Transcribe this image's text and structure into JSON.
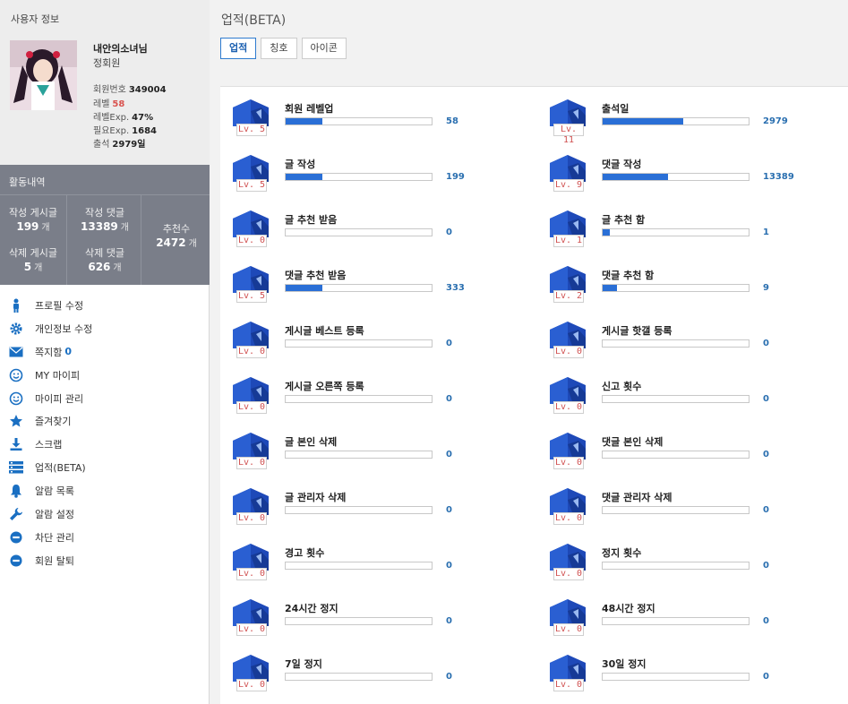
{
  "user": {
    "header": "사용자 정보",
    "nickname": "내안의소녀님",
    "grade": "정회원",
    "stats": [
      {
        "label": "회원번호",
        "value": "349004",
        "red": false
      },
      {
        "label": "레벨",
        "value": "58",
        "red": true
      },
      {
        "label": "레벨Exp.",
        "value": "47%",
        "red": false
      },
      {
        "label": "필요Exp.",
        "value": "1684",
        "red": false
      },
      {
        "label": "출석",
        "value": "2979일",
        "red": false
      }
    ]
  },
  "activity": {
    "title": "활동내역",
    "posts_label": "작성 게시글",
    "posts_value": "199",
    "posts_unit": "개",
    "comments_label": "작성 댓글",
    "comments_value": "13389",
    "comments_unit": "개",
    "del_posts_label": "삭제 게시글",
    "del_posts_value": "5",
    "del_posts_unit": "개",
    "del_comments_label": "삭제 댓글",
    "del_comments_value": "626",
    "del_comments_unit": "개",
    "recommend_label": "추천수",
    "recommend_value": "2472",
    "recommend_unit": "개"
  },
  "menu": [
    {
      "label": "프로필 수정",
      "icon": "person-icon"
    },
    {
      "label": "개인정보 수정",
      "icon": "gear-icon"
    },
    {
      "label": "쪽지함",
      "icon": "mail-icon",
      "count": "0"
    },
    {
      "label": "MY 마이피",
      "icon": "smiley-icon"
    },
    {
      "label": "마이피 관리",
      "icon": "smiley-icon"
    },
    {
      "label": "즐겨찾기",
      "icon": "star-icon"
    },
    {
      "label": "스크랩",
      "icon": "download-icon"
    },
    {
      "label": "업적(BETA)",
      "icon": "list-icon"
    },
    {
      "label": "알람 목록",
      "icon": "bell-icon"
    },
    {
      "label": "알람 설정",
      "icon": "wrench-icon"
    },
    {
      "label": "차단 관리",
      "icon": "minus-circle-icon"
    },
    {
      "label": "회원 탈퇴",
      "icon": "minus-circle-icon"
    }
  ],
  "main": {
    "title": "업적(BETA)",
    "tabs": [
      {
        "label": "업적",
        "active": true
      },
      {
        "label": "칭호",
        "active": false
      },
      {
        "label": "아이콘",
        "active": false
      }
    ]
  },
  "achievements": [
    {
      "name": "회원 레벨업",
      "level": "Lv. 5",
      "value": "58",
      "progress": 0.25
    },
    {
      "name": "출석일",
      "level": "Lv. 11",
      "value": "2979",
      "progress": 0.55
    },
    {
      "name": "글 작성",
      "level": "Lv. 5",
      "value": "199",
      "progress": 0.25
    },
    {
      "name": "댓글 작성",
      "level": "Lv. 9",
      "value": "13389",
      "progress": 0.45
    },
    {
      "name": "글 추천 받음",
      "level": "Lv. 0",
      "value": "0",
      "progress": 0
    },
    {
      "name": "글 추천 함",
      "level": "Lv. 1",
      "value": "1",
      "progress": 0.05
    },
    {
      "name": "댓글 추천 받음",
      "level": "Lv. 5",
      "value": "333",
      "progress": 0.25
    },
    {
      "name": "댓글 추천 함",
      "level": "Lv. 2",
      "value": "9",
      "progress": 0.1
    },
    {
      "name": "게시글 베스트 등록",
      "level": "Lv. 0",
      "value": "0",
      "progress": 0
    },
    {
      "name": "게시글 핫갤 등록",
      "level": "Lv. 0",
      "value": "0",
      "progress": 0
    },
    {
      "name": "게시글 오른쪽 등록",
      "level": "Lv. 0",
      "value": "0",
      "progress": 0
    },
    {
      "name": "신고 횟수",
      "level": "Lv. 0",
      "value": "0",
      "progress": 0
    },
    {
      "name": "글 본인 삭제",
      "level": "Lv. 0",
      "value": "0",
      "progress": 0
    },
    {
      "name": "댓글 본인 삭제",
      "level": "Lv. 0",
      "value": "0",
      "progress": 0
    },
    {
      "name": "글 관리자 삭제",
      "level": "Lv. 0",
      "value": "0",
      "progress": 0
    },
    {
      "name": "댓글 관리자 삭제",
      "level": "Lv. 0",
      "value": "0",
      "progress": 0
    },
    {
      "name": "경고 횟수",
      "level": "Lv. 0",
      "value": "0",
      "progress": 0
    },
    {
      "name": "정지 횟수",
      "level": "Lv. 0",
      "value": "0",
      "progress": 0
    },
    {
      "name": "24시간 정지",
      "level": "Lv. 0",
      "value": "0",
      "progress": 0
    },
    {
      "name": "48시간 정지",
      "level": "Lv. 0",
      "value": "0",
      "progress": 0
    },
    {
      "name": "7일 정지",
      "level": "Lv. 0",
      "value": "0",
      "progress": 0
    },
    {
      "name": "30일 정지",
      "level": "Lv. 0",
      "value": "0",
      "progress": 0
    }
  ],
  "colors": {
    "accent": "#2a6fd6",
    "value_text": "#2a6fb0",
    "level_text": "#d05050",
    "activity_bg": "#7a7e89"
  }
}
